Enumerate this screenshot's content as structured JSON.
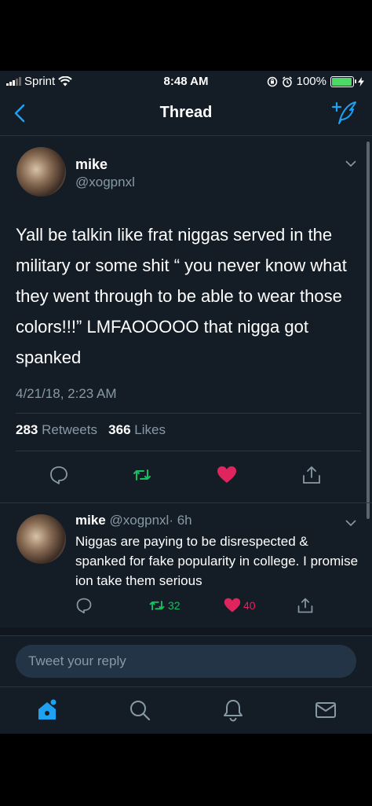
{
  "status_bar": {
    "carrier": "Sprint",
    "time": "8:48 AM",
    "battery": "100%"
  },
  "nav": {
    "title": "Thread"
  },
  "main_tweet": {
    "name": "mike",
    "handle": "@xogpnxl",
    "text": "Yall be talkin like frat niggas served in the military or some shit “ you never know what they went through to be able to wear those colors!!!” LMFAOOOOO that nigga got spanked",
    "date": "4/21/18, 2:23 AM",
    "retweets_count": "283",
    "retweets_label": "Retweets",
    "likes_count": "366",
    "likes_label": "Likes"
  },
  "reply_tweet": {
    "name": "mike",
    "handle": "@xogpnxl",
    "time": "· 6h",
    "text": "Niggas are paying to be disrespected & spanked for fake popularity in college. I promise ion take them serious",
    "retweets": "32",
    "likes": "40"
  },
  "composer": {
    "placeholder": "Tweet your reply"
  },
  "colors": {
    "background": "#141d26",
    "accent": "#1da1f2",
    "retweet": "#17bf63",
    "like": "#e0245e",
    "secondary_text": "#8899a6"
  },
  "icons": {
    "back": "chevron-left-icon",
    "compose": "compose-tweet-icon",
    "reply": "reply-icon",
    "retweet": "retweet-icon",
    "like": "heart-icon",
    "share": "share-icon",
    "home": "home-icon",
    "search": "search-icon",
    "notifications": "bell-icon",
    "messages": "mail-icon"
  }
}
